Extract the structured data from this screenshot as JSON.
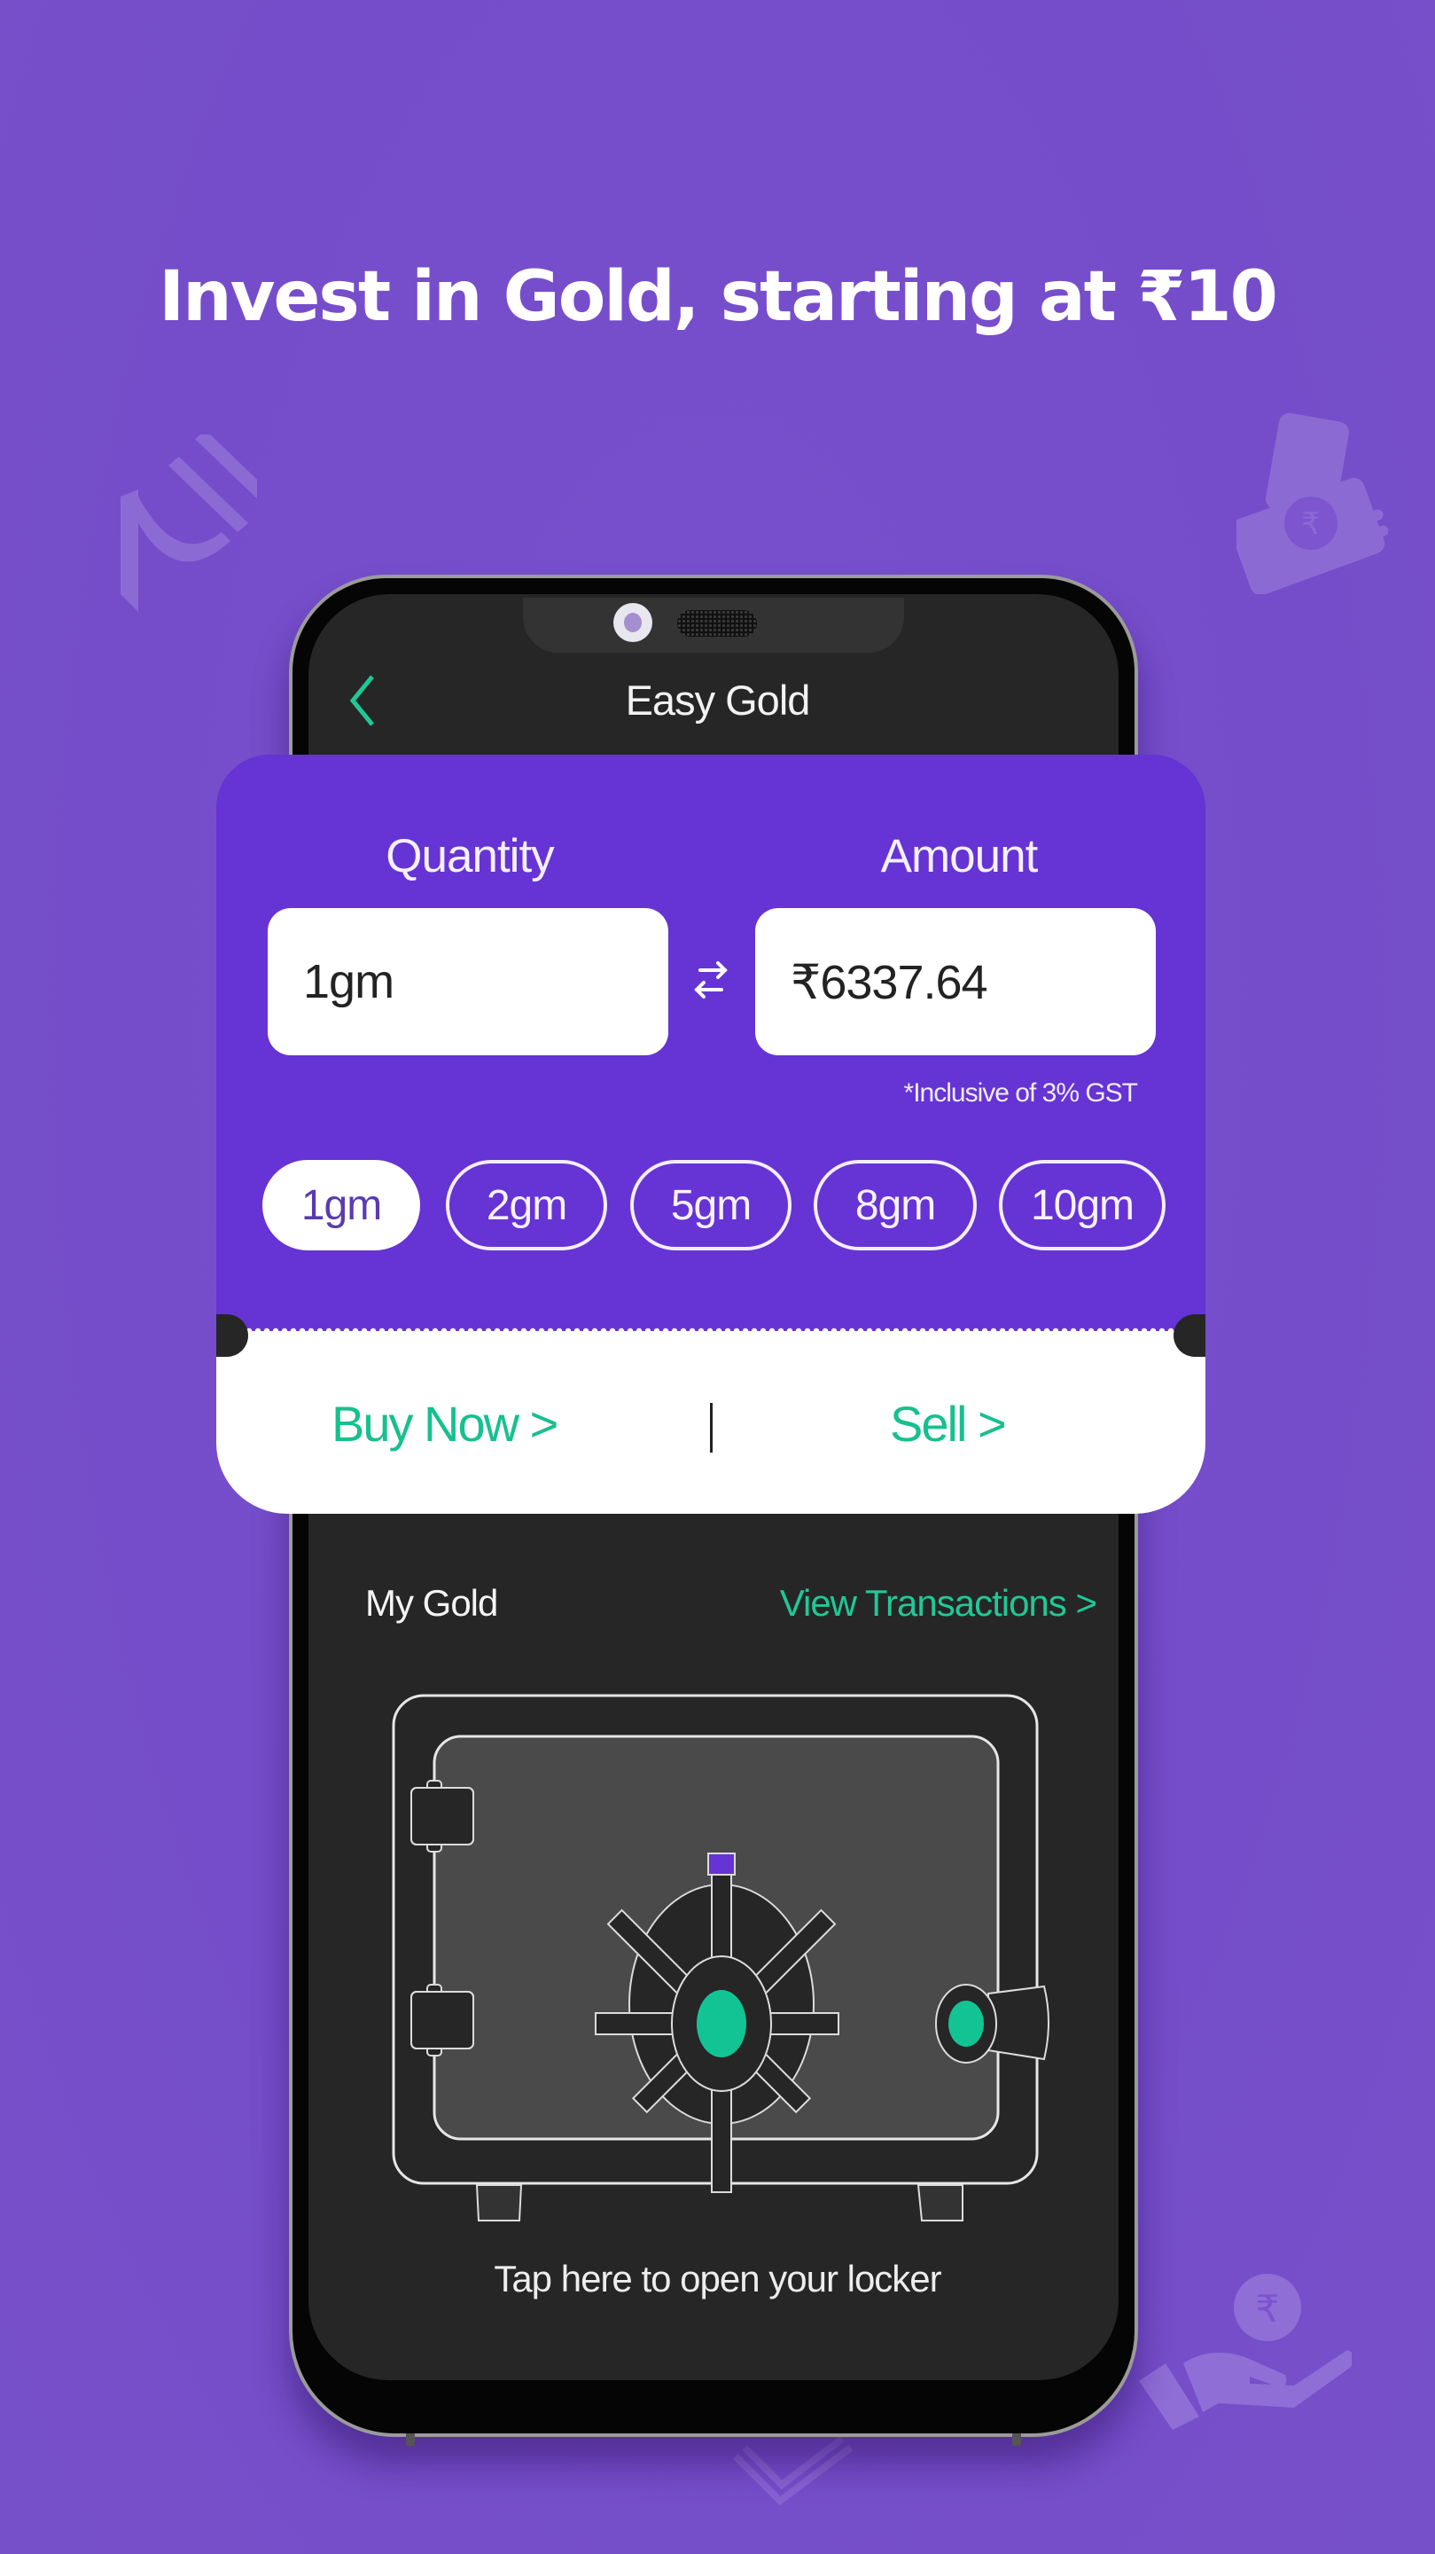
{
  "headline": "Invest in Gold, starting at ₹10",
  "decorations": [
    "rupee-symbol-icon",
    "rupee-cash-stack-icon",
    "hand-holding-rupee-icon",
    "money-bundle-icon"
  ],
  "app": {
    "screen_title": "Easy Gold",
    "back_icon": "chevron-left-icon"
  },
  "converter": {
    "quantity_label": "Quantity",
    "amount_label": "Amount",
    "quantity_value": "1gm",
    "amount_value": "₹6337.64",
    "swap_icon": "swap-arrows-icon",
    "gst_note": "*Inclusive of 3% GST",
    "presets": [
      {
        "label": "1gm",
        "selected": true
      },
      {
        "label": "2gm",
        "selected": false
      },
      {
        "label": "5gm",
        "selected": false
      },
      {
        "label": "8gm",
        "selected": false
      },
      {
        "label": "10gm",
        "selected": false
      }
    ]
  },
  "actions": {
    "buy_label": "Buy Now >",
    "sell_label": "Sell >"
  },
  "my_gold": {
    "title": "My Gold",
    "view_transactions": "View Transactions >",
    "locker_icon": "safe-locker-icon",
    "tap_hint": "Tap here to open your locker"
  },
  "colors": {
    "background": "#774fcc",
    "card_purple": "#6633d4",
    "accent_green": "#17c08e",
    "screen_dark": "#262626"
  }
}
